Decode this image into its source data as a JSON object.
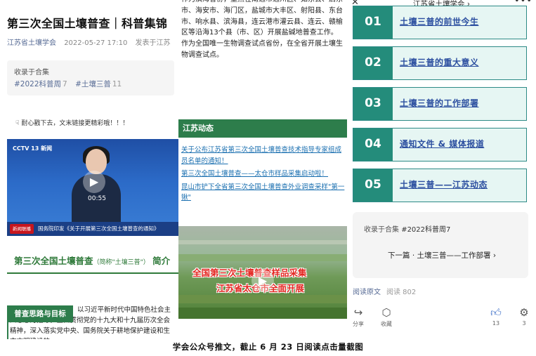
{
  "left": {
    "title": "第三次全国土壤普查｜科普集锦",
    "account": "江苏省土壤学会",
    "date": "2022-05-27 17:10",
    "published_in": "发表于江苏",
    "collection_label": "收录于合集",
    "tags": [
      {
        "name": "#2022科普周",
        "count": "7"
      },
      {
        "name": "#土壤三普",
        "count": "11"
      }
    ],
    "hint_icon": "hand-pointer-icon",
    "hint": "耐心戳下去，文末链接更精彩哦！！！",
    "video": {
      "logo": "CCTV 13 新闻",
      "duration": "00:55",
      "news_badge": "新闻联播",
      "caption": "国务院印发《关于开展第三次全国土壤普查的通知》"
    },
    "section_title": "第三次全国土壤普查",
    "section_title_small": "（简称\"土壤三普\"）",
    "section_title_end": "简介",
    "box_label": "普查思路与目标",
    "box_text": "以习近平新时代中国特色社会主义思想为指导，全面贯彻党的十九大和十九届历次全会精神，深入落实党中央、国务院关于耕地保护建设和生态文明建设的"
  },
  "middle": {
    "paragraphs": [
      "作为滨海省份，重点在南通市通州区、如东县、启东市、海安市、海门区，盐城市大丰区、射阳县、东台市、响水县、滨海县，连云港市灌云县、连云、赣榆区等沿海13个县（市、区）开展盐碱地普查工作。",
      "作为全国唯一生物调查试点省份，在全省开展土壤生物调查试点。"
    ],
    "banner": "江苏动态",
    "links": [
      "关于公布江苏省第三次全国土壤普查技术指导专家组成员名单的通知！",
      "第三次全国土壤普查——太仓市样品采集启动啦！",
      "昆山市铲下全省第三次全国土壤普查外业调查采样\"第一锹\""
    ],
    "video_line1": "全国第三次土壤普查样品采集",
    "video_line2": "江苏省太仓市全面开展"
  },
  "right": {
    "account": "江苏省土壤学会",
    "items": [
      {
        "num": "01",
        "text": "土壤三普的前世今生"
      },
      {
        "num": "02",
        "text": "土壤三普的重大意义"
      },
      {
        "num": "03",
        "text": "土壤三普的工作部署"
      },
      {
        "num": "04",
        "text": "通知文件 & 媒体报道"
      },
      {
        "num": "05",
        "text": "土壤三普——江苏动态"
      }
    ],
    "collection": "收录于合集",
    "collection_tag": "#2022科普周7",
    "next": "下一篇 · 土壤三普——工作部署",
    "read_original": "阅读原文",
    "read_count": "阅读 802",
    "actions": {
      "share": "分享",
      "favorite": "收藏",
      "like_count": "13",
      "wow_count": "3"
    }
  },
  "footer": "学会公众号推文，截止 6 月 23 日阅读点击量截图",
  "colors": {
    "green": "#2d7d4b",
    "teal": "#248c7b",
    "link": "#1a6fb0"
  }
}
